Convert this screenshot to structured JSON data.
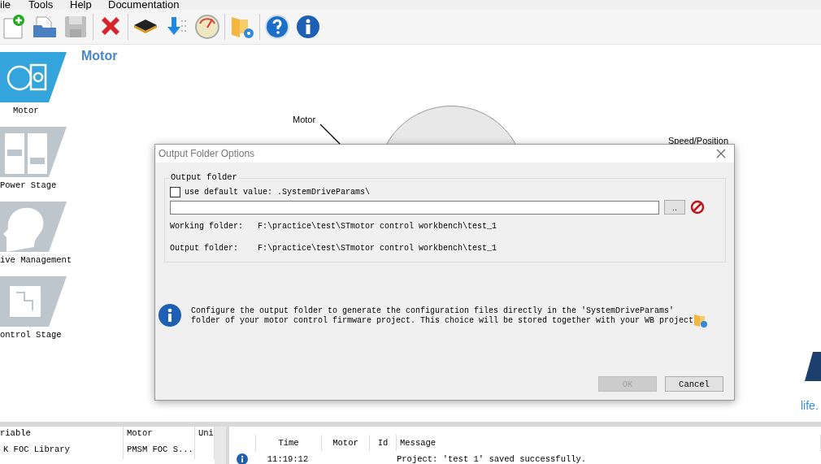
{
  "menu": [
    "ile",
    "Tools",
    "Help",
    "Documentation"
  ],
  "toolbar": [
    {
      "kind": "new",
      "disabled": false
    },
    {
      "kind": "open",
      "disabled": false
    },
    {
      "kind": "save",
      "disabled": true
    },
    {
      "kind": "separator"
    },
    {
      "kind": "delete",
      "disabled": false
    },
    {
      "kind": "separator"
    },
    {
      "kind": "chip",
      "disabled": false
    },
    {
      "kind": "download",
      "disabled": false
    },
    {
      "kind": "gauge",
      "disabled": false
    },
    {
      "kind": "separator"
    },
    {
      "kind": "folder",
      "disabled": false
    },
    {
      "kind": "separator"
    },
    {
      "kind": "help",
      "disabled": false
    },
    {
      "kind": "info",
      "disabled": false
    }
  ],
  "sidebar": {
    "items": [
      {
        "kind": "motor",
        "label": "Motor",
        "selected": true
      },
      {
        "kind": "power",
        "label": "Power Stage",
        "selected": false
      },
      {
        "kind": "brain",
        "label": "ive Management",
        "selected": false
      },
      {
        "kind": "chip",
        "label": "ontrol Stage",
        "selected": false
      }
    ]
  },
  "canvas": {
    "title": "Motor",
    "motor_label": "Motor",
    "speed_label": "Speed/Position",
    "corner_label": "life."
  },
  "dialog": {
    "title": "Output Folder Options",
    "group_title": "Output folder",
    "checkbox": {
      "label": "use default value: .SystemDriveParams\\",
      "checked": false
    },
    "browse_button": "..",
    "folders": [
      {
        "label": "Working folder:",
        "value": "F:\\practice\\test\\STmotor control workbench\\test_1"
      },
      {
        "label": "Output folder:",
        "value": "F:\\practice\\test\\STmotor control workbench\\test_1"
      }
    ],
    "info_lines": [
      "Configure the output folder to generate the configuration files directly in the 'SystemDriveParams'",
      "folder of your motor control firmware project. This choice will be stored together with your WB project"
    ],
    "buttons": [
      {
        "label": "OK",
        "disabled": true
      },
      {
        "label": "Cancel",
        "disabled": false
      }
    ]
  },
  "variables": {
    "columns": [
      "riable",
      "Motor",
      "Uni"
    ],
    "rows": [
      [
        "K FOC Library",
        "PMSM FOC S..."
      ]
    ]
  },
  "log": {
    "columns": [
      "Time",
      "Motor",
      "Id",
      "Message"
    ],
    "rows": [
      {
        "kind": "info",
        "time": "11:19:12",
        "message": "Project: 'test 1' saved successfully."
      }
    ]
  }
}
